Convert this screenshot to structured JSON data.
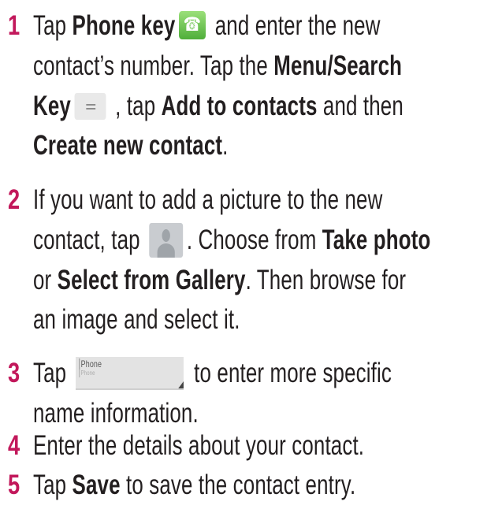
{
  "colors": {
    "step_number": "#c2185b",
    "text": "#231f20"
  },
  "steps": [
    {
      "number": "1",
      "lines": [
        [
          "Tap ",
          "Phone key",
          " and enter the new"
        ],
        [
          "contact’s number. Tap the ",
          "Menu/Search"
        ],
        [
          "Key",
          " , tap ",
          "Add to contacts",
          " and then"
        ],
        [
          "Create new contact",
          "."
        ]
      ],
      "icons": [
        "phone-key-icon",
        "menu-search-key-icon"
      ]
    },
    {
      "number": "2",
      "lines": [
        [
          "If you want to add a picture to the new"
        ],
        [
          "contact, tap ",
          ". Choose from ",
          "Take photo"
        ],
        [
          "or ",
          "Select from Gallery",
          ". Then browse for"
        ],
        [
          "an image and select it."
        ]
      ],
      "icons": [
        "contact-picture-icon"
      ]
    },
    {
      "number": "3",
      "field": {
        "label": "Phone",
        "sub": "Phone"
      },
      "lines": [
        [
          "Tap ",
          " to enter more specific"
        ],
        [
          "name information."
        ]
      ]
    },
    {
      "number": "4",
      "lines": [
        [
          "Enter the details about your contact."
        ]
      ]
    },
    {
      "number": "5",
      "lines": [
        [
          "Tap ",
          "Save",
          " to save the contact entry."
        ]
      ]
    }
  ]
}
